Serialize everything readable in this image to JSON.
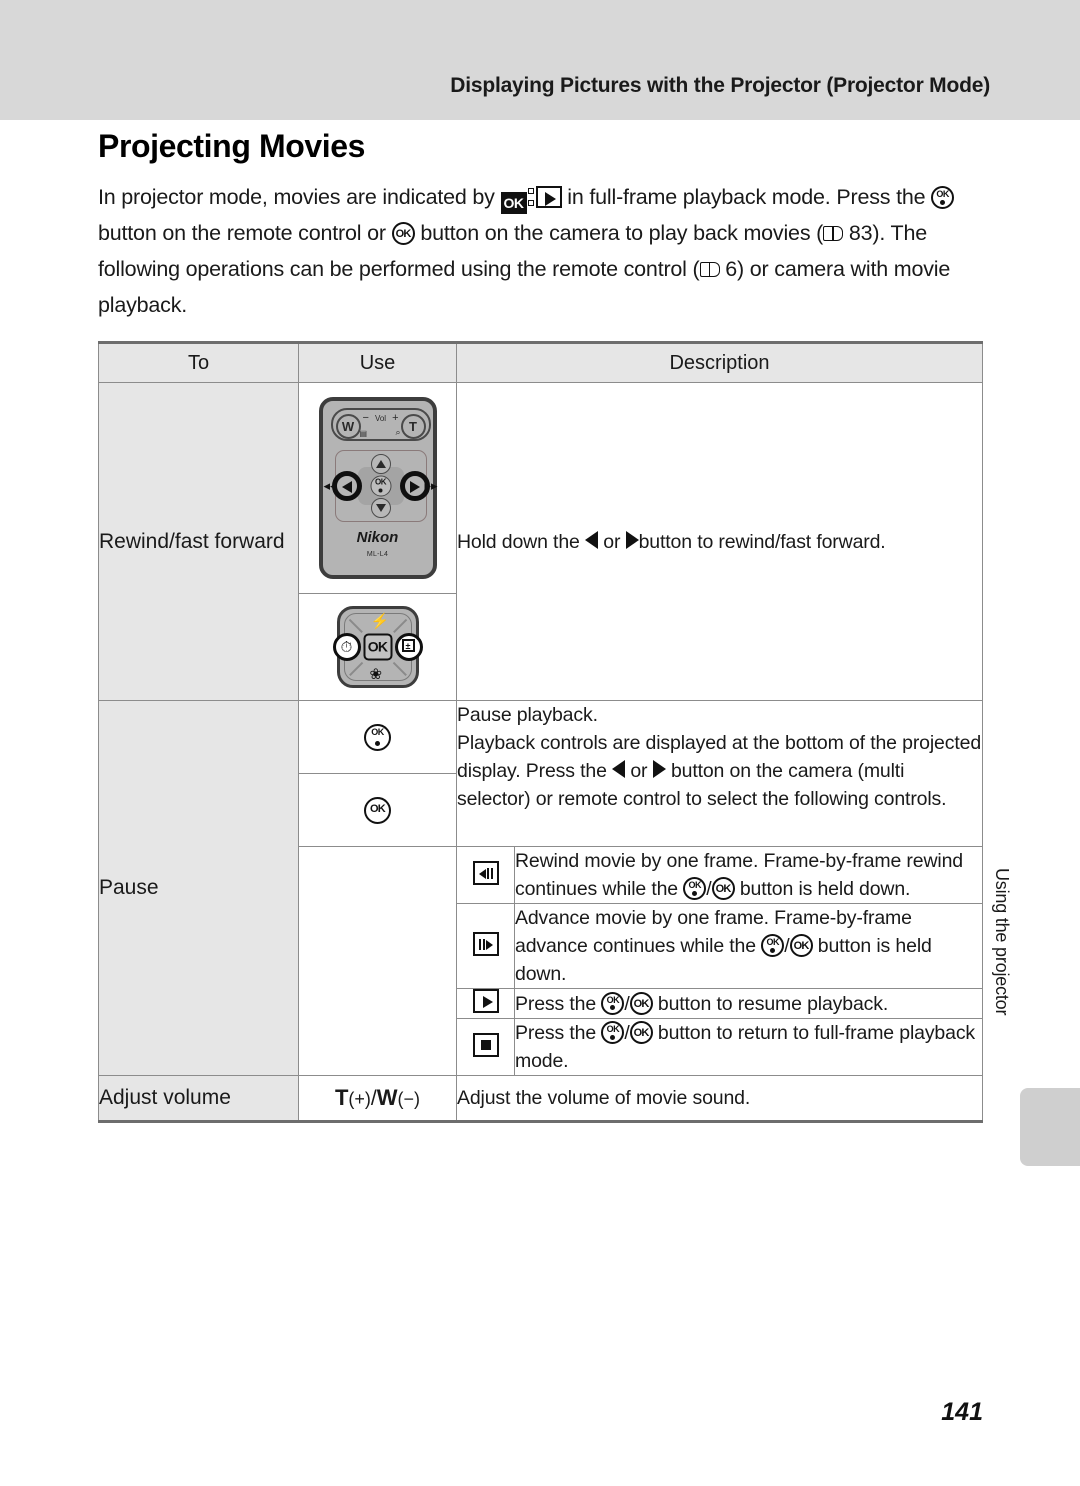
{
  "header": {
    "running_title": "Displaying Pictures with the Projector (Projector Mode)"
  },
  "page": {
    "title": "Projecting Movies",
    "folio": "141",
    "side_tab": "Using the projector"
  },
  "intro": {
    "line1_a": "In projector mode, movies are indicated by",
    "line1_b": "in full-frame playback mode.",
    "line2_a": "Press the",
    "line2_b": "button on the remote control or",
    "line2_c": "button on the camera to play",
    "line3_a": "back movies (",
    "line3_ref": "83",
    "line3_b": "). The following operations can be performed using the",
    "line4_a": "remote control (",
    "line4_ref": "6",
    "line4_b": ") or camera with movie playback."
  },
  "table": {
    "headers": {
      "to": "To",
      "use": "Use",
      "description": "Description"
    },
    "rows": {
      "rewind": {
        "to": "Rewind/fast forward",
        "desc_a": "Hold down the",
        "desc_or": "or",
        "desc_b": "button to rewind/fast forward."
      },
      "pause": {
        "to": "Pause",
        "desc_line1": "Pause playback.",
        "desc_line2a": "Playback controls are displayed at the bottom of the projected display. Press the",
        "desc_or": "or",
        "desc_line2b": "button on the camera (multi selector) or remote control to select the following controls."
      },
      "frame_rewind": {
        "icon": "frame-rewind-icon",
        "desc_a": "Rewind movie by one frame. Frame-by-frame rewind continues while the",
        "desc_slash": "/",
        "desc_b": "button is held down."
      },
      "frame_advance": {
        "icon": "frame-advance-icon",
        "desc_a": "Advance movie by one frame. Frame-by-frame advance continues while the",
        "desc_slash": "/",
        "desc_b": "button is held down."
      },
      "resume": {
        "icon": "play-icon",
        "desc_a": "Press the",
        "desc_slash": "/",
        "desc_b": "button to resume playback."
      },
      "fullframe": {
        "icon": "stop-icon",
        "desc_a": "Press the",
        "desc_slash": "/",
        "desc_b": "button to return to full-frame playback mode."
      },
      "volume": {
        "to": "Adjust volume",
        "use_t": "T",
        "use_t_sign": "(+)",
        "use_slash": "/",
        "use_w": "W",
        "use_w_sign": "(−)",
        "desc": "Adjust the volume of movie sound."
      }
    }
  },
  "remote": {
    "w_label": "W",
    "t_label": "T",
    "vol_label": "Vol",
    "minus": "−",
    "plus": "+",
    "thumbnail_icon": "thumbnail-icon",
    "magnify_icon": "magnify-icon",
    "brand": "Nikon",
    "model": "ML-L4"
  },
  "multi_selector": {
    "ok_label": "OK",
    "flash_icon": "flash-icon",
    "self_timer_icon": "self-timer-icon",
    "exposure_icon": "exposure-compensation-icon",
    "macro_icon": "macro-icon"
  },
  "colors": {
    "header_band": "#d8d8d8",
    "table_header": "#e6e6e6",
    "table_border": "#8c8c8c",
    "side_tab": "#cfcfcf"
  }
}
